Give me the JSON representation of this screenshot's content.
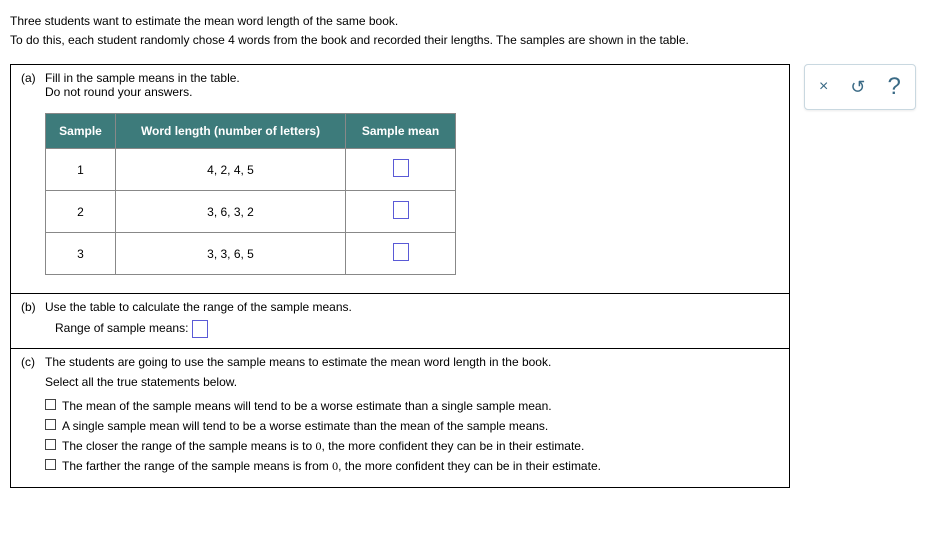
{
  "intro": {
    "line1": "Three students want to estimate the mean word length of the same book.",
    "line2": "To do this, each student randomly chose 4 words from the book and recorded their lengths. The samples are shown in the table."
  },
  "partA": {
    "label": "(a)",
    "text1": "Fill in the sample means in the table.",
    "text2": "Do not round your answers.",
    "headers": {
      "sample": "Sample",
      "lengths": "Word length (number of letters)",
      "mean": "Sample mean"
    },
    "rows": [
      {
        "sample": "1",
        "lengths": "4, 2, 4, 5"
      },
      {
        "sample": "2",
        "lengths": "3, 6, 3, 2"
      },
      {
        "sample": "3",
        "lengths": "3, 3, 6, 5"
      }
    ]
  },
  "partB": {
    "label": "(b)",
    "text": "Use the table to calculate the range of the sample means.",
    "rangeLabel": "Range of sample means:"
  },
  "partC": {
    "label": "(c)",
    "text": "The students are going to use the sample means to estimate the mean word length in the book.",
    "select": "Select all the true statements below.",
    "statements": [
      "The mean of the sample means will tend to be a worse estimate than a single sample mean.",
      "A single sample mean will tend to be a worse estimate than the mean of the sample means.",
      "The closer the range of the sample means is to 0, the more confident they can be in their estimate.",
      "The farther the range of the sample means is from 0, the more confident they can be in their estimate."
    ]
  },
  "actions": {
    "close": "×",
    "reset": "↺",
    "help": "?"
  }
}
